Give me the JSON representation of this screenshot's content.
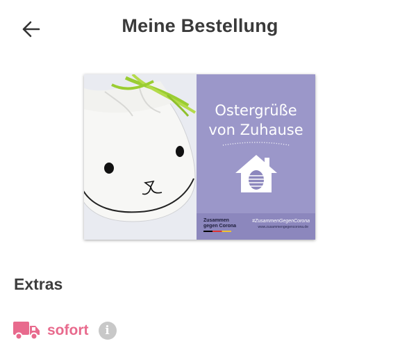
{
  "header": {
    "title": "Meine Bestellung",
    "back_icon": "arrow-left-icon"
  },
  "card": {
    "heading_line1": "Ostergrüße",
    "heading_line2": "von Zuhause",
    "house_icon": "house-with-easter-egg-icon",
    "logo_line1": "Zusammen",
    "logo_line2": "gegen Corona",
    "hashtag": "#ZusammenGegenCorona",
    "url": "www.zusammengegencorona.de",
    "colors": {
      "purple": "#9b97c9",
      "footer": "#8c87bd",
      "ribbon": "#9acd32"
    }
  },
  "extras": {
    "title": "Extras",
    "items": [
      {
        "label": "sofort",
        "icon": "truck-icon",
        "info_icon": "info-icon",
        "info_glyph": "i"
      }
    ],
    "accent_color": "#e86a8d"
  }
}
